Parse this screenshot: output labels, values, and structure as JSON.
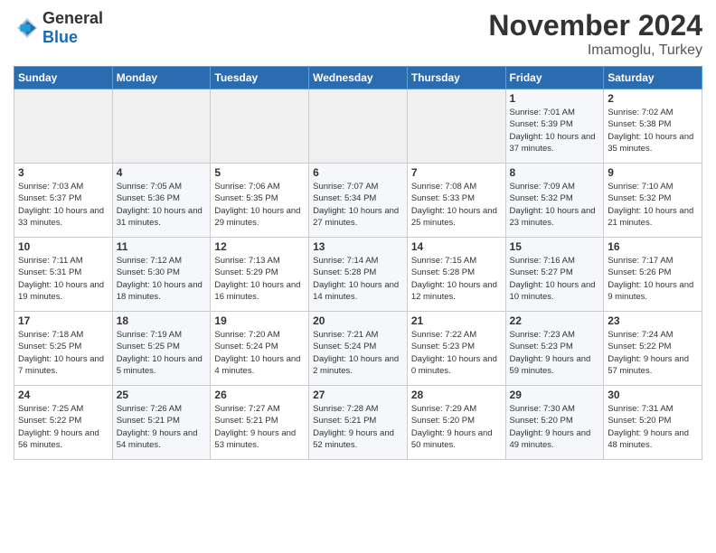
{
  "header": {
    "logo_general": "General",
    "logo_blue": "Blue",
    "month": "November 2024",
    "location": "Imamoglu, Turkey"
  },
  "weekdays": [
    "Sunday",
    "Monday",
    "Tuesday",
    "Wednesday",
    "Thursday",
    "Friday",
    "Saturday"
  ],
  "weeks": [
    [
      {
        "day": "",
        "info": ""
      },
      {
        "day": "",
        "info": ""
      },
      {
        "day": "",
        "info": ""
      },
      {
        "day": "",
        "info": ""
      },
      {
        "day": "",
        "info": ""
      },
      {
        "day": "1",
        "info": "Sunrise: 7:01 AM\nSunset: 5:39 PM\nDaylight: 10 hours and 37 minutes."
      },
      {
        "day": "2",
        "info": "Sunrise: 7:02 AM\nSunset: 5:38 PM\nDaylight: 10 hours and 35 minutes."
      }
    ],
    [
      {
        "day": "3",
        "info": "Sunrise: 7:03 AM\nSunset: 5:37 PM\nDaylight: 10 hours and 33 minutes."
      },
      {
        "day": "4",
        "info": "Sunrise: 7:05 AM\nSunset: 5:36 PM\nDaylight: 10 hours and 31 minutes."
      },
      {
        "day": "5",
        "info": "Sunrise: 7:06 AM\nSunset: 5:35 PM\nDaylight: 10 hours and 29 minutes."
      },
      {
        "day": "6",
        "info": "Sunrise: 7:07 AM\nSunset: 5:34 PM\nDaylight: 10 hours and 27 minutes."
      },
      {
        "day": "7",
        "info": "Sunrise: 7:08 AM\nSunset: 5:33 PM\nDaylight: 10 hours and 25 minutes."
      },
      {
        "day": "8",
        "info": "Sunrise: 7:09 AM\nSunset: 5:32 PM\nDaylight: 10 hours and 23 minutes."
      },
      {
        "day": "9",
        "info": "Sunrise: 7:10 AM\nSunset: 5:32 PM\nDaylight: 10 hours and 21 minutes."
      }
    ],
    [
      {
        "day": "10",
        "info": "Sunrise: 7:11 AM\nSunset: 5:31 PM\nDaylight: 10 hours and 19 minutes."
      },
      {
        "day": "11",
        "info": "Sunrise: 7:12 AM\nSunset: 5:30 PM\nDaylight: 10 hours and 18 minutes."
      },
      {
        "day": "12",
        "info": "Sunrise: 7:13 AM\nSunset: 5:29 PM\nDaylight: 10 hours and 16 minutes."
      },
      {
        "day": "13",
        "info": "Sunrise: 7:14 AM\nSunset: 5:28 PM\nDaylight: 10 hours and 14 minutes."
      },
      {
        "day": "14",
        "info": "Sunrise: 7:15 AM\nSunset: 5:28 PM\nDaylight: 10 hours and 12 minutes."
      },
      {
        "day": "15",
        "info": "Sunrise: 7:16 AM\nSunset: 5:27 PM\nDaylight: 10 hours and 10 minutes."
      },
      {
        "day": "16",
        "info": "Sunrise: 7:17 AM\nSunset: 5:26 PM\nDaylight: 10 hours and 9 minutes."
      }
    ],
    [
      {
        "day": "17",
        "info": "Sunrise: 7:18 AM\nSunset: 5:25 PM\nDaylight: 10 hours and 7 minutes."
      },
      {
        "day": "18",
        "info": "Sunrise: 7:19 AM\nSunset: 5:25 PM\nDaylight: 10 hours and 5 minutes."
      },
      {
        "day": "19",
        "info": "Sunrise: 7:20 AM\nSunset: 5:24 PM\nDaylight: 10 hours and 4 minutes."
      },
      {
        "day": "20",
        "info": "Sunrise: 7:21 AM\nSunset: 5:24 PM\nDaylight: 10 hours and 2 minutes."
      },
      {
        "day": "21",
        "info": "Sunrise: 7:22 AM\nSunset: 5:23 PM\nDaylight: 10 hours and 0 minutes."
      },
      {
        "day": "22",
        "info": "Sunrise: 7:23 AM\nSunset: 5:23 PM\nDaylight: 9 hours and 59 minutes."
      },
      {
        "day": "23",
        "info": "Sunrise: 7:24 AM\nSunset: 5:22 PM\nDaylight: 9 hours and 57 minutes."
      }
    ],
    [
      {
        "day": "24",
        "info": "Sunrise: 7:25 AM\nSunset: 5:22 PM\nDaylight: 9 hours and 56 minutes."
      },
      {
        "day": "25",
        "info": "Sunrise: 7:26 AM\nSunset: 5:21 PM\nDaylight: 9 hours and 54 minutes."
      },
      {
        "day": "26",
        "info": "Sunrise: 7:27 AM\nSunset: 5:21 PM\nDaylight: 9 hours and 53 minutes."
      },
      {
        "day": "27",
        "info": "Sunrise: 7:28 AM\nSunset: 5:21 PM\nDaylight: 9 hours and 52 minutes."
      },
      {
        "day": "28",
        "info": "Sunrise: 7:29 AM\nSunset: 5:20 PM\nDaylight: 9 hours and 50 minutes."
      },
      {
        "day": "29",
        "info": "Sunrise: 7:30 AM\nSunset: 5:20 PM\nDaylight: 9 hours and 49 minutes."
      },
      {
        "day": "30",
        "info": "Sunrise: 7:31 AM\nSunset: 5:20 PM\nDaylight: 9 hours and 48 minutes."
      }
    ]
  ]
}
